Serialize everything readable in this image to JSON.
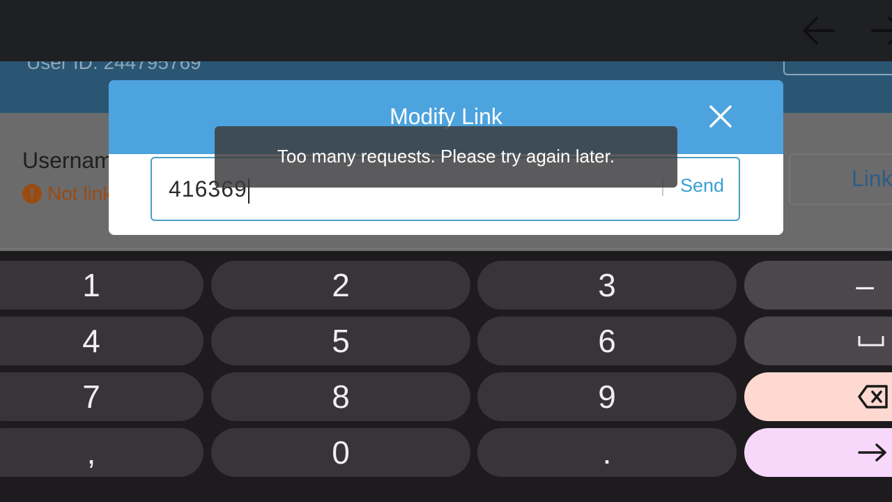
{
  "app": {
    "user_id": "User ID: 244795769",
    "username_label": "Usernam",
    "status_text": "Not link",
    "link_button": "Link"
  },
  "modal": {
    "title": "Modify Link",
    "field_value": "416369",
    "send_label": "Send"
  },
  "toast": {
    "message": "Too many requests. Please try again later."
  },
  "keyboard": {
    "keys": [
      "1",
      "2",
      "3",
      "–",
      "4",
      "5",
      "6",
      "7",
      "8",
      "9",
      ",",
      "0",
      "."
    ]
  },
  "colors": {
    "modal_header": "#4da3de",
    "send_text": "#3c9fd2",
    "status_warning": "#9a4b12",
    "delete_key": "#fdd9d2",
    "enter_key": "#f8d8fa"
  }
}
